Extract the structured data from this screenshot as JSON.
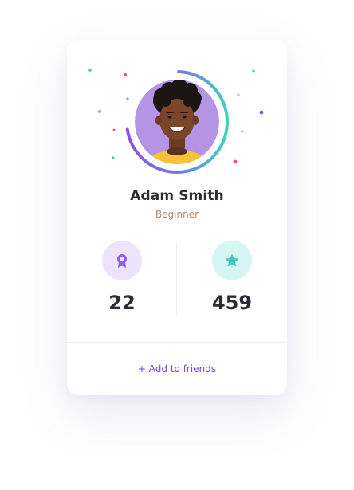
{
  "profile": {
    "name": "Adam Smith",
    "level": "Beginner",
    "progress": 0.72
  },
  "stats": [
    {
      "icon": "award-ribbon-icon",
      "value": "22",
      "badge_color": "#ece3fc",
      "icon_color": "#8f5cf0"
    },
    {
      "icon": "star-icon",
      "value": "459",
      "badge_color": "#d6f6f3",
      "icon_color": "#3fc9bd"
    }
  ],
  "actions": {
    "add_friends_label": "+ Add to friends"
  },
  "colors": {
    "accent": "#7b3fe4",
    "ring_start": "#8a4ff0",
    "ring_end": "#3fd1c4",
    "avatar_bg": "#b594e6"
  }
}
